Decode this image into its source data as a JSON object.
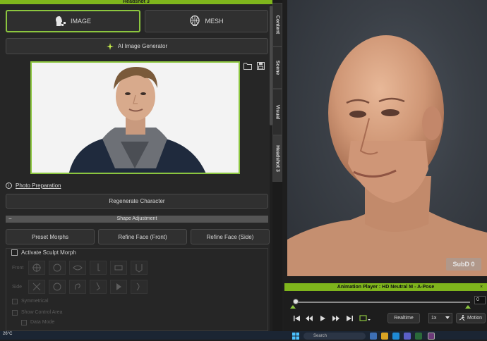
{
  "left_panel": {
    "title": "Headshot 3",
    "close": "×",
    "mode_buttons": {
      "image": "IMAGE",
      "mesh": "MESH"
    },
    "ai_generator": "AI Image Generator",
    "photo_preparation": "Photo Preparation",
    "info_glyph": "i",
    "regenerate": "Regenerate Character",
    "shape_adjustment": {
      "header": "Shape Adjustment",
      "collapse_glyph": "−",
      "buttons": {
        "preset": "Preset Morphs",
        "front": "Refine Face (Front)",
        "side": "Refine Face (Side)"
      }
    },
    "sculpt": {
      "label": "Activate Sculpt Morph",
      "row_front": "Front",
      "row_side": "Side",
      "opt_symmetrical": "Symmetrical",
      "opt_show_control": "Show Control Area",
      "opt_data_mode": "Data Mode"
    }
  },
  "vertical_tabs": [
    "Content",
    "Scene",
    "Visual",
    "Headshot 3"
  ],
  "viewport": {
    "subd_label": "SubD 0"
  },
  "animation_player": {
    "title": "Animation Player : HD Neutral M - A-Pose",
    "close": "×",
    "frame_value": "0",
    "realtime": "Realtime",
    "speed": "1x",
    "motion": "Motion"
  },
  "taskbar": {
    "temperature": "26°C",
    "search_placeholder": "Search"
  },
  "colors": {
    "accent": "#8cc63f",
    "panel": "#262626",
    "title_bar": "#7fb51c"
  }
}
